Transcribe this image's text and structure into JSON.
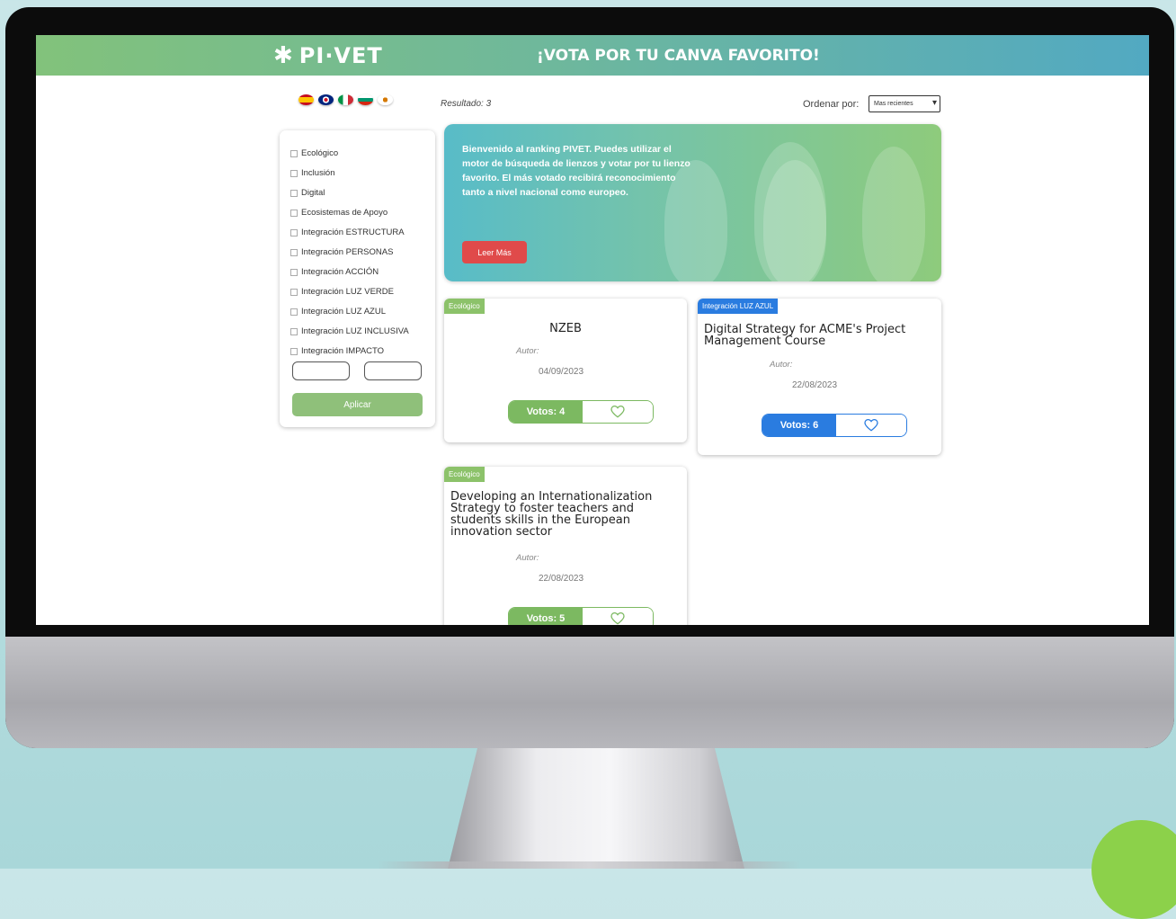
{
  "header": {
    "logo": "PI·VET",
    "headline": "¡VOTA POR TU CANVA FAVORITO!"
  },
  "languages": [
    "es",
    "en",
    "it",
    "bg",
    "cy"
  ],
  "toolbar": {
    "result": "Resultado: 3",
    "sort_label": "Ordenar por:",
    "sort_selected": "Mas recientes"
  },
  "filters": {
    "items": [
      "Ecológico",
      "Inclusión",
      "Digital",
      "Ecosistemas de Apoyo",
      "Integración ESTRUCTURA",
      "Integración PERSONAS",
      "Integración ACCIÓN",
      "Integración LUZ VERDE",
      "Integración LUZ AZUL",
      "Integración LUZ INCLUSIVA",
      "Integración IMPACTO"
    ],
    "date_from": "",
    "date_to": "",
    "apply_label": "Aplicar"
  },
  "banner": {
    "text": "Bienvenido al ranking PIVET. Puedes utilizar el motor de búsqueda de lienzos y votar por tu lienzo favorito. El más votado recibirá reconocimiento tanto a nivel nacional como europeo.",
    "button": "Leer Más"
  },
  "cards": [
    {
      "tag": "Ecológico",
      "title": "NZEB",
      "author": "Autor:",
      "date": "04/09/2023",
      "votes": "Votos: 4"
    },
    {
      "tag": "Integración LUZ AZUL",
      "title": "Digital Strategy for ACME's Project Management Course",
      "author": "Autor:",
      "date": "22/08/2023",
      "votes": "Votos: 6"
    },
    {
      "tag": "Ecológico",
      "title": "Developing an Internationalization Strategy to foster teachers and students skills in the European innovation sector",
      "author": "Autor:",
      "date": "22/08/2023",
      "votes": "Votos: 5"
    }
  ],
  "colors": {
    "header_start": "#82c27b",
    "header_end": "#52a9c2",
    "tag_green": "#8cc26a",
    "tag_blue": "#2a7ce0",
    "button_red": "#e04a4a"
  }
}
